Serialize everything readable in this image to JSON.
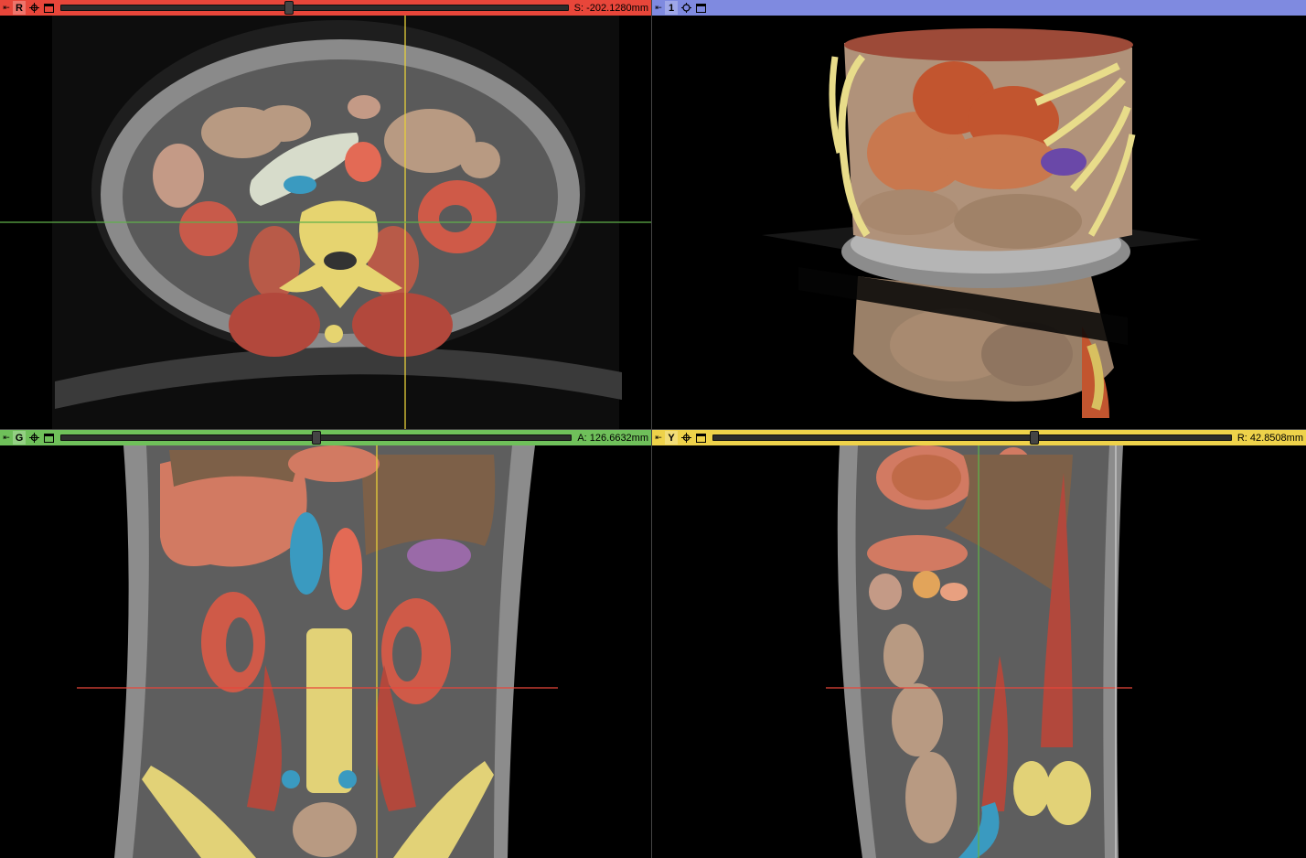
{
  "views": {
    "red": {
      "letter": "R",
      "value": "S: -202.1280mm",
      "slider_fraction": 0.45,
      "color": "#e8463a"
    },
    "threeD": {
      "letter": "1",
      "color": "#7f8ae0"
    },
    "green": {
      "letter": "G",
      "value": "A: 126.6632mm",
      "slider_fraction": 0.5,
      "color": "#6fc05a"
    },
    "yellow": {
      "letter": "Y",
      "value": "R: 42.8508mm",
      "slider_fraction": 0.62,
      "color": "#eed24a"
    }
  },
  "icons": {
    "pin": "pin-icon",
    "link": "link-icon",
    "window": "maximize-icon",
    "camera": "camera-center-icon"
  }
}
